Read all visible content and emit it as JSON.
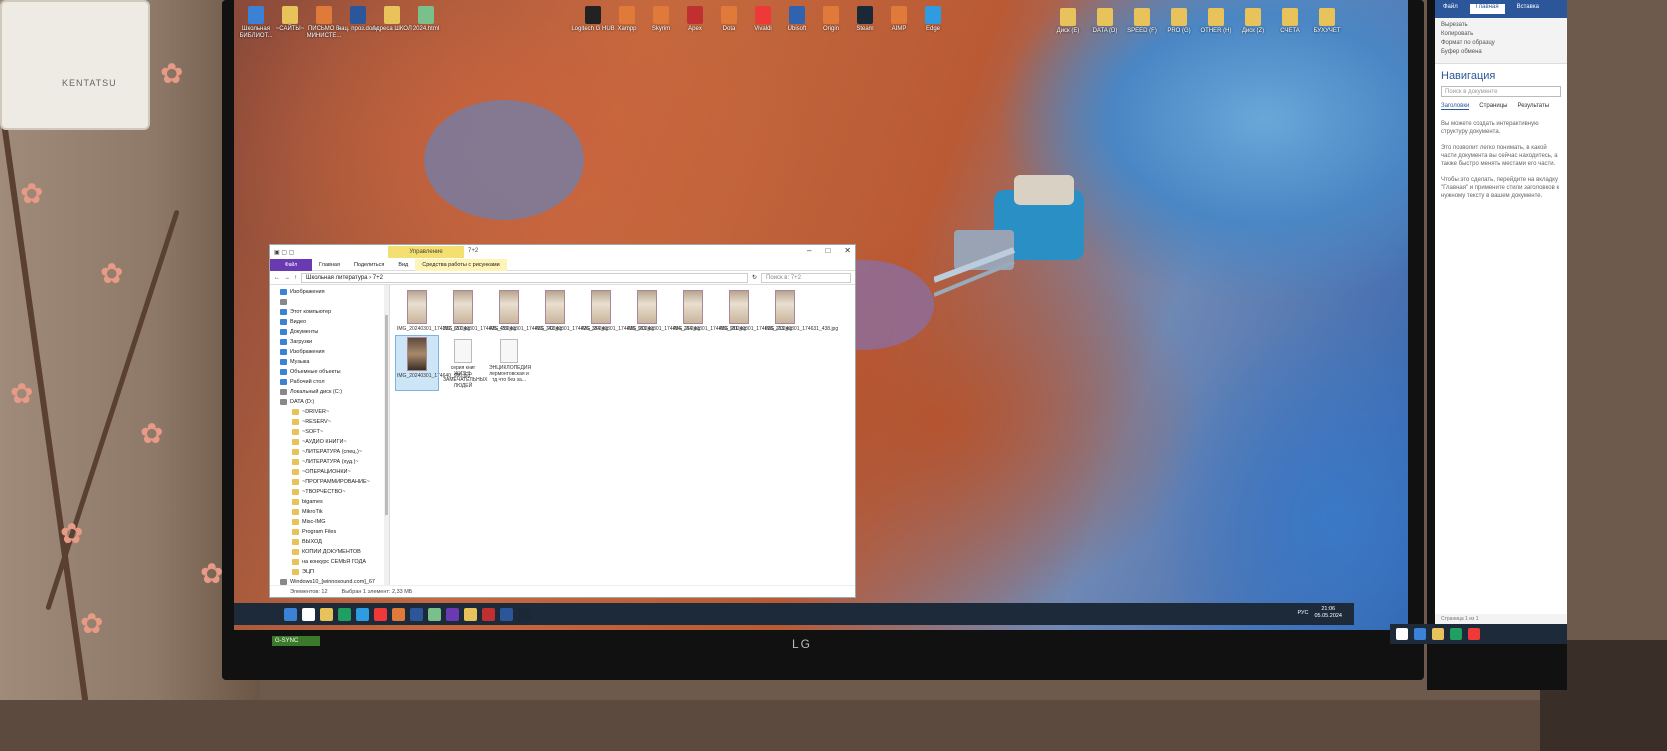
{
  "monitor": {
    "brand": "LG",
    "gsync": "G-SYNC"
  },
  "wall": {
    "ac_brand": "KENTATSU"
  },
  "desktop_icons_top": [
    {
      "label": "Школьная БИБЛИОТ...",
      "color": "#3b82d6"
    },
    {
      "label": "~САЙТЫ~",
      "color": "#e8c25a"
    },
    {
      "label": "ПИСЬМО В МИНИСТЕ...",
      "color": "#e07a3a"
    },
    {
      "label": "нац. проз.docx",
      "color": "#2b579a"
    },
    {
      "label": "Адреса ШКОЛ",
      "color": "#e8c25a"
    },
    {
      "label": "2024.html",
      "color": "#7ac08a"
    }
  ],
  "desktop_icons_mid": [
    {
      "label": "Logitech G HUB",
      "color": "#222"
    },
    {
      "label": "Xampp",
      "color": "#e07a3a"
    },
    {
      "label": "Skyrim",
      "color": "#e07a3a"
    },
    {
      "label": "Apex",
      "color": "#c03030"
    },
    {
      "label": "Dota",
      "color": "#e07a3a"
    },
    {
      "label": "Vivaldi",
      "color": "#ef3939"
    },
    {
      "label": "Ubisoft",
      "color": "#2f63b0"
    },
    {
      "label": "Origin",
      "color": "#e07a3a"
    },
    {
      "label": "Steam",
      "color": "#1b2838"
    },
    {
      "label": "AIMP",
      "color": "#e07a3a"
    },
    {
      "label": "Edge",
      "color": "#2f9be0"
    }
  ],
  "desktop_icons_right": [
    {
      "label": "Диск (E)",
      "color": "#e8c25a"
    },
    {
      "label": "DATA (D)",
      "color": "#e8c25a"
    },
    {
      "label": "SPEED (F)",
      "color": "#e8c25a"
    },
    {
      "label": "PRO (G)",
      "color": "#e8c25a"
    },
    {
      "label": "OTHER (H)",
      "color": "#e8c25a"
    },
    {
      "label": "Диск (Z)",
      "color": "#e8c25a"
    },
    {
      "label": "СЧЕТА",
      "color": "#e8c25a"
    },
    {
      "label": "БУХУЧЕТ",
      "color": "#e8c25a"
    }
  ],
  "explorer": {
    "context_tab": "Управление",
    "name": "7+2",
    "tabs": [
      "Файл",
      "Главная",
      "Поделиться",
      "Вид",
      "Средства работы с рисунками"
    ],
    "address": "Школьная литература  ›  7+2",
    "search_placeholder": "Поиск в: 7+2",
    "nav_items": [
      {
        "label": "Изображения",
        "type": "blue"
      },
      {
        "label": "",
        "type": "gray"
      },
      {
        "label": "Этот компьютер",
        "type": "blue"
      },
      {
        "label": "Видео",
        "type": "blue"
      },
      {
        "label": "Документы",
        "type": "blue"
      },
      {
        "label": "Загрузки",
        "type": "blue"
      },
      {
        "label": "Изображения",
        "type": "blue"
      },
      {
        "label": "Музыка",
        "type": "blue"
      },
      {
        "label": "Объемные объекты",
        "type": "blue"
      },
      {
        "label": "Рабочий стол",
        "type": "blue"
      },
      {
        "label": "Локальный диск (C:)",
        "type": "gray"
      },
      {
        "label": "DATA (D:)",
        "type": "gray"
      },
      {
        "label": "~DRIVER~",
        "type": "folder"
      },
      {
        "label": "~RESERV~",
        "type": "folder"
      },
      {
        "label": "~SOFT~",
        "type": "folder"
      },
      {
        "label": "~АУДИО КНИГИ~",
        "type": "folder"
      },
      {
        "label": "~ЛИТЕРАТУРА (спец.)~",
        "type": "folder"
      },
      {
        "label": "~ЛИТЕРАТУРА (худ.)~",
        "type": "folder"
      },
      {
        "label": "~ОПЕРАЦИОНКИ~",
        "type": "folder"
      },
      {
        "label": "~ПРОГРАММИРОВАНИЕ~",
        "type": "folder"
      },
      {
        "label": "~ТВОРЧЕСТВО~",
        "type": "folder"
      },
      {
        "label": "bigames",
        "type": "folder"
      },
      {
        "label": "MikroTik",
        "type": "folder"
      },
      {
        "label": "Misc-IMG",
        "type": "folder"
      },
      {
        "label": "Program Files",
        "type": "folder"
      },
      {
        "label": "ВЫХОД",
        "type": "folder"
      },
      {
        "label": "КОПИИ ДОКУМЕНТОВ",
        "type": "folder"
      },
      {
        "label": "на конкурс СЕМЬЯ ГОДА",
        "type": "folder"
      },
      {
        "label": "ЭЦП",
        "type": "folder"
      },
      {
        "label": "Windows10_[winnosound.com]_67",
        "type": "gray"
      },
      {
        "label": "SPEED (E:)",
        "type": "gray"
      }
    ],
    "files": [
      {
        "name": "IMG_20240301_174352_657.jpg",
        "kind": "img",
        "selected": false
      },
      {
        "name": "IMG_20240301_174405_459.jpg",
        "kind": "img",
        "selected": false
      },
      {
        "name": "IMG_20240301_174413_742.jpg",
        "kind": "img",
        "selected": false
      },
      {
        "name": "IMG_20240301_174426_384.jpg",
        "kind": "img",
        "selected": false
      },
      {
        "name": "IMG_20240301_174438_963.jpg",
        "kind": "img",
        "selected": false
      },
      {
        "name": "IMG_20240301_174454_264.jpg",
        "kind": "img",
        "selected": false
      },
      {
        "name": "IMG_20240301_174459_981.jpg",
        "kind": "img",
        "selected": false
      },
      {
        "name": "IMG_20240301_174618_213.jpg",
        "kind": "img",
        "selected": false
      },
      {
        "name": "IMG_20240301_174631_438.jpg",
        "kind": "img",
        "selected": false
      },
      {
        "name": "IMG_20240301_174640_986.jpg",
        "kind": "img",
        "selected": true
      },
      {
        "name": "серия книг ЖИЗНЬ ЗАМЕЧАТЕЛЬНЫХ ЛЮДЕЙ",
        "kind": "doc",
        "selected": false
      },
      {
        "name": "ЭНЦИКЛОПЕДИЯ лермонтовская и тд что без за...",
        "kind": "doc",
        "selected": false
      }
    ],
    "status": {
      "count": "Элементов: 12",
      "selected": "Выбран 1 элемент: 2,33 МБ"
    }
  },
  "taskbar": {
    "icons": [
      "#3b82d6",
      "#ffffff",
      "#e8c25a",
      "#20a060",
      "#2f9be0",
      "#ef3939",
      "#e07a3a",
      "#2b579a",
      "#7ac08a",
      "#6a3ab2",
      "#e8c25a",
      "#c03030",
      "#2b579a",
      "#1b2838"
    ],
    "lang": "РУС",
    "time": "21:06",
    "date": "05.05.2024"
  },
  "word": {
    "tabs": [
      "Файл",
      "Главная",
      "Вставка"
    ],
    "ribbon": [
      "Вырезать",
      "Копировать",
      "Формат по образцу",
      "Буфер обмена"
    ],
    "nav_title": "Навигация",
    "search_placeholder": "Поиск в документе",
    "nav_tabs": [
      "Заголовки",
      "Страницы",
      "Результаты"
    ],
    "help_text": [
      "Вы можете создать интерактивную структуру документа.",
      "Это позволит легко понимать, в какой части документа вы сейчас находитесь, а также быстро менять местами его части.",
      "Чтобы это сделать, перейдите на вкладку \"Главная\" и примените стили заголовков к нужному тексту в вашем документе."
    ],
    "status": "Страница 1 из 1"
  }
}
